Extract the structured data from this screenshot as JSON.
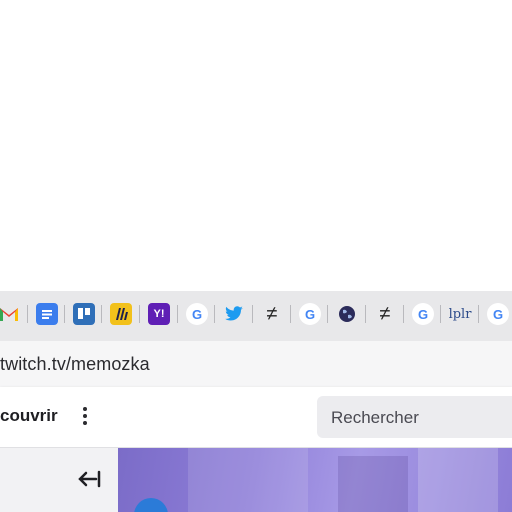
{
  "bookmarks": {
    "items": [
      {
        "icon": "gmail-icon",
        "glyph": "M",
        "color": "#e94235"
      },
      {
        "icon": "docs-icon",
        "glyph": "",
        "color": "#3b7ded"
      },
      {
        "icon": "trello-icon",
        "glyph": "",
        "color": "#2f6fb8"
      },
      {
        "icon": "miro-icon",
        "glyph": "",
        "color": "#f2c11b"
      },
      {
        "icon": "yahoo-icon",
        "glyph": "Y!",
        "color": "#5f1fb5"
      },
      {
        "icon": "google-icon",
        "glyph": "G",
        "color": "#4285f4"
      },
      {
        "icon": "twitter-icon",
        "glyph": "",
        "color": "#1d9bf0"
      },
      {
        "icon": "not-equal-icon",
        "glyph": "≠",
        "color": "#222222"
      },
      {
        "icon": "google-icon",
        "glyph": "G",
        "color": "#4285f4"
      },
      {
        "icon": "globe-icon",
        "glyph": "",
        "color": "#2b2b5a"
      },
      {
        "icon": "not-equal-icon",
        "glyph": "≠",
        "color": "#222222"
      },
      {
        "icon": "google-icon",
        "glyph": "G",
        "color": "#4285f4"
      },
      {
        "icon": "bookmark-site-icon",
        "glyph": "lplr",
        "color": "#2b4a8a"
      },
      {
        "icon": "google-icon",
        "glyph": "G",
        "color": "#4285f4"
      }
    ]
  },
  "address_bar": {
    "url": "twitch.tv/memozka"
  },
  "twitch_header": {
    "browse_label": "couvrir",
    "search_placeholder": "Rechercher"
  },
  "colors": {
    "accent": "#9147ff",
    "content_bg": "#8f7fd9"
  }
}
